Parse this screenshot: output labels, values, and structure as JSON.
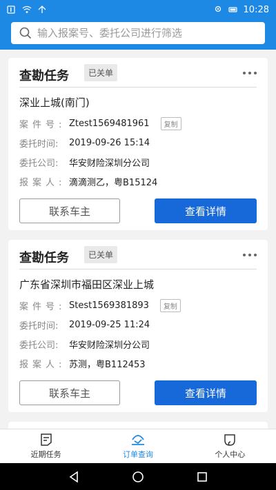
{
  "status": {
    "time": "10:28",
    "left_icons": [
      "notification-icon",
      "wifi-icon",
      "signal-icon"
    ],
    "right_icons": [
      "location-icon",
      "battery-icon"
    ]
  },
  "search": {
    "placeholder": "输入报案号、委托公司进行筛选"
  },
  "cards": [
    {
      "title": "查勘任务",
      "badge": "已关单",
      "address": "深业上城(南门)",
      "case_label": "案件号:",
      "case_no": "Ztest1569481961",
      "copy_label": "复制",
      "time_label": "委托时间:",
      "time": "2019-09-26 15:14",
      "company_label": "委托公司:",
      "company": "华安财险深圳分公司",
      "reporter_label": "报案人:",
      "reporter": "滴滴测乙，粤B15124",
      "contact_label": "联系车主",
      "detail_label": "查看详情"
    },
    {
      "title": "查勘任务",
      "badge": "已关单",
      "address": "广东省深圳市福田区深业上城",
      "case_label": "案件号:",
      "case_no": "Stest1569381893",
      "copy_label": "复制",
      "time_label": "委托时间:",
      "time": "2019-09-25 11:24",
      "company_label": "委托公司:",
      "company": "华安财险深圳分公司",
      "reporter_label": "报案人:",
      "reporter": "苏测，粤B112453",
      "contact_label": "联系车主",
      "detail_label": "查看详情"
    }
  ],
  "tabs": [
    {
      "label": "近期任务",
      "icon": "task-list-icon",
      "active": false
    },
    {
      "label": "订单查询",
      "icon": "order-search-icon",
      "active": true
    },
    {
      "label": "个人中心",
      "icon": "profile-icon",
      "active": false
    }
  ],
  "colors": {
    "brand": "#1e88e5",
    "primary_button": "#1768d8"
  }
}
